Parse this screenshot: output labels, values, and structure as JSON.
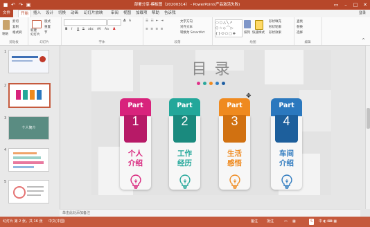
{
  "window": {
    "title": "部署分享-模板图（20200314） - PowerPoint(产品激活失败)",
    "quick_access": [
      "save-icon",
      "undo-icon",
      "redo-icon",
      "present-icon"
    ]
  },
  "tabs": [
    "文件",
    "开始",
    "插入",
    "设计",
    "切换",
    "动画",
    "幻灯片放映",
    "审阅",
    "视图",
    "加载项",
    "帮助",
    "告诉我"
  ],
  "user": "登录",
  "ribbon": {
    "groups": [
      "剪贴板",
      "幻灯片",
      "字体",
      "段落",
      "绘图",
      "编辑"
    ],
    "clipboard": {
      "paste": "粘贴",
      "cut": "剪切",
      "copy": "复制",
      "format": "格式刷"
    },
    "slides": {
      "new": "新建\n幻灯片",
      "layout": "版式",
      "reset": "重置",
      "section": "节"
    },
    "font": {
      "bold": "B",
      "italic": "I",
      "underline": "U",
      "strike": "S",
      "shadow": "abc",
      "spacing": "AV",
      "case": "Aa"
    },
    "paragraph": {
      "text_direction": "文字方向",
      "align_text": "对齐文本",
      "smartart": "转换为 SmartArt"
    },
    "drawing": {
      "arrange": "排列",
      "quick_styles": "快速样式",
      "shape_fill": "形状填充",
      "shape_outline": "形状轮廓",
      "shape_effects": "形状效果"
    },
    "editing": {
      "find": "查找",
      "replace": "替换",
      "select": "选择"
    }
  },
  "slides_panel": {
    "numbers": [
      "1",
      "2",
      "3",
      "4",
      "5"
    ],
    "thumb3_text": "个人简介"
  },
  "slide": {
    "title": "目  录",
    "dot_colors": [
      "#e0328a",
      "#2aa79b",
      "#f08a1e",
      "#2f7dc1",
      "#1f5fa3"
    ],
    "cards": [
      {
        "part": "Part",
        "num": "1",
        "label_l1": "个人",
        "label_l2": "介绍",
        "color": "#d8237c",
        "dark": "#b71a67"
      },
      {
        "part": "Part",
        "num": "2",
        "label_l1": "工作",
        "label_l2": "经历",
        "color": "#23a79a",
        "dark": "#1a8a7e"
      },
      {
        "part": "Part",
        "num": "3",
        "label_l1": "生活",
        "label_l2": "感悟",
        "color": "#ef8a1f",
        "dark": "#d17111"
      },
      {
        "part": "Part",
        "num": "4",
        "label_l1": "车间",
        "label_l2": "介绍",
        "color": "#2b78be",
        "dark": "#1d5f9c"
      }
    ]
  },
  "notes_placeholder": "单击此处添加备注",
  "status": {
    "slide_info": "幻灯片 第 2 张，共 16 张",
    "language": "中文(中国)",
    "notes_btn": "备注",
    "comments_btn": "批注"
  }
}
